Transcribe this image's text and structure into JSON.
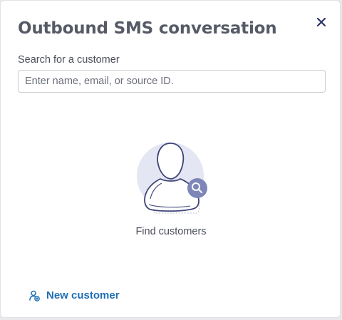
{
  "dialog": {
    "title": "Outbound SMS conversation",
    "close_icon": "close-icon"
  },
  "search": {
    "label": "Search for a customer",
    "placeholder": "Enter name, email, or source ID.",
    "value": ""
  },
  "empty_state": {
    "illustration": "person-search-illustration",
    "text": "Find customers"
  },
  "footer": {
    "new_customer_label": "New customer",
    "new_customer_icon": "add-person-icon"
  },
  "colors": {
    "title": "#565a66",
    "accent_link": "#1f6fb5",
    "close_icon": "#2c3563",
    "illustration_circle": "#e4e6f3",
    "illustration_badge": "#7e86b8"
  }
}
